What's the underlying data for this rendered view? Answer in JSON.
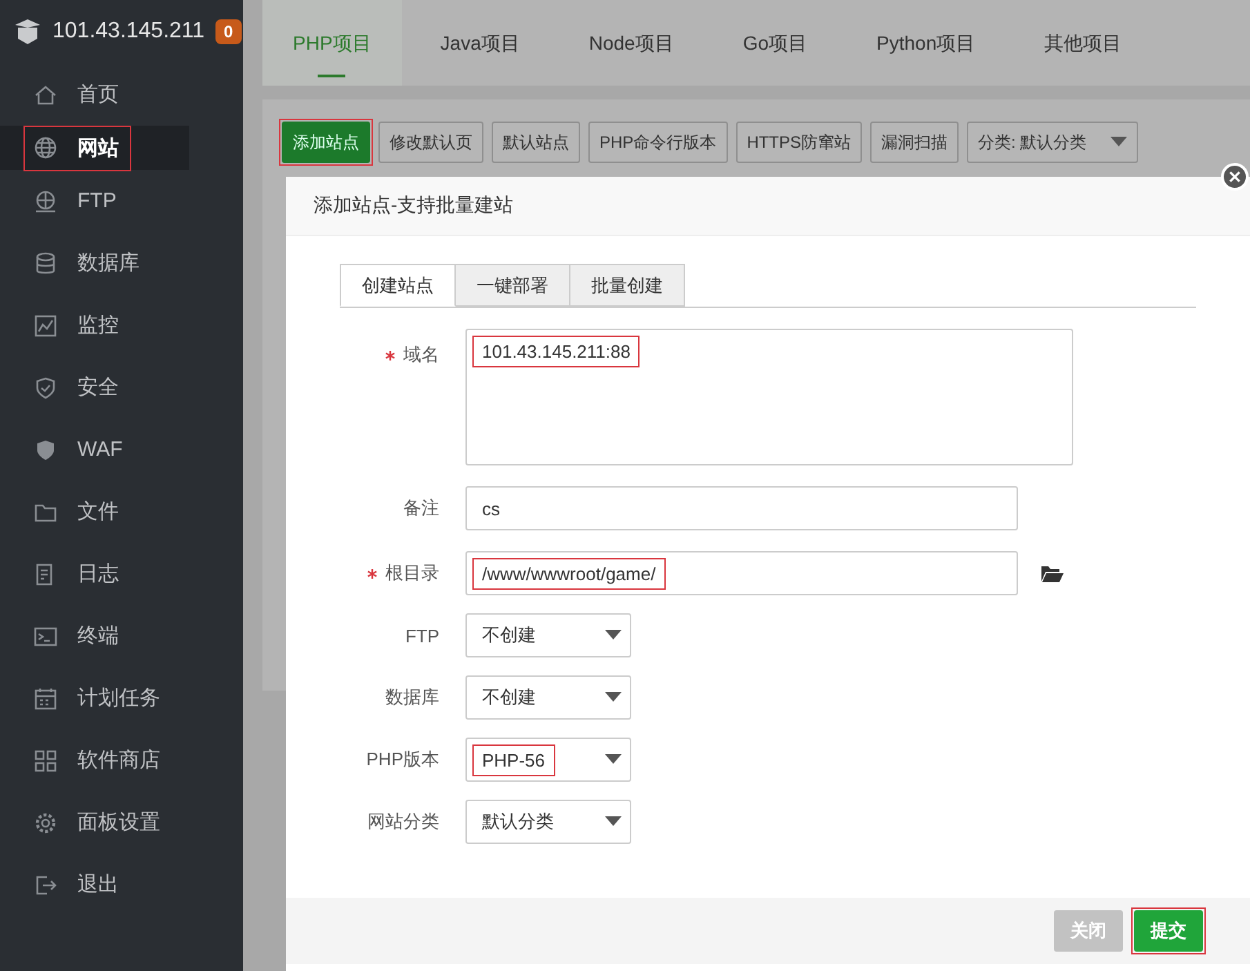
{
  "sidebar": {
    "server": "101.43.145.211",
    "badge": "0",
    "items": [
      {
        "label": "首页",
        "selected": false,
        "highlighted": false
      },
      {
        "label": "网站",
        "selected": true,
        "highlighted": true
      },
      {
        "label": "FTP",
        "selected": false,
        "highlighted": false
      },
      {
        "label": "数据库",
        "selected": false,
        "highlighted": false
      },
      {
        "label": "监控",
        "selected": false,
        "highlighted": false
      },
      {
        "label": "安全",
        "selected": false,
        "highlighted": false
      },
      {
        "label": "WAF",
        "selected": false,
        "highlighted": false
      },
      {
        "label": "文件",
        "selected": false,
        "highlighted": false
      },
      {
        "label": "日志",
        "selected": false,
        "highlighted": false
      },
      {
        "label": "终端",
        "selected": false,
        "highlighted": false
      },
      {
        "label": "计划任务",
        "selected": false,
        "highlighted": false
      },
      {
        "label": "软件商店",
        "selected": false,
        "highlighted": false
      },
      {
        "label": "面板设置",
        "selected": false,
        "highlighted": false
      },
      {
        "label": "退出",
        "selected": false,
        "highlighted": false
      }
    ]
  },
  "tabs": [
    {
      "label": "PHP项目",
      "selected": true
    },
    {
      "label": "Java项目",
      "selected": false
    },
    {
      "label": "Node项目",
      "selected": false
    },
    {
      "label": "Go项目",
      "selected": false
    },
    {
      "label": "Python项目",
      "selected": false
    },
    {
      "label": "其他项目",
      "selected": false
    }
  ],
  "toolbar": [
    {
      "label": "添加站点",
      "kind": "primary",
      "highlighted": true
    },
    {
      "label": "修改默认页",
      "kind": "plain",
      "highlighted": false
    },
    {
      "label": "默认站点",
      "kind": "plain",
      "highlighted": false
    },
    {
      "label": "PHP命令行版本",
      "kind": "plain",
      "highlighted": false
    },
    {
      "label": "HTTPS防窜站",
      "kind": "plain",
      "highlighted": false
    },
    {
      "label": "漏洞扫描",
      "kind": "plain",
      "highlighted": false
    },
    {
      "label": "分类: 默认分类",
      "kind": "select",
      "highlighted": false
    }
  ],
  "dialog": {
    "title": "添加站点-支持批量建站",
    "tabs": [
      {
        "label": "创建站点",
        "selected": true
      },
      {
        "label": "一键部署",
        "selected": false
      },
      {
        "label": "批量创建",
        "selected": false
      }
    ],
    "fields": [
      {
        "label": "域名",
        "required": true,
        "kind": "textarea",
        "value": "101.43.145.211:88",
        "highlighted": true
      },
      {
        "label": "备注",
        "required": false,
        "kind": "input",
        "value": "cs",
        "highlighted": false
      },
      {
        "label": "根目录",
        "required": true,
        "kind": "path",
        "value": "/www/wwwroot/game/",
        "highlighted": true
      },
      {
        "label": "FTP",
        "required": false,
        "kind": "select",
        "value": "不创建",
        "highlighted": false
      },
      {
        "label": "数据库",
        "required": false,
        "kind": "select",
        "value": "不创建",
        "highlighted": false
      },
      {
        "label": "PHP版本",
        "required": false,
        "kind": "select",
        "value": "PHP-56",
        "highlighted": true
      },
      {
        "label": "网站分类",
        "required": false,
        "kind": "select",
        "value": "默认分类",
        "highlighted": false
      }
    ],
    "buttons": [
      {
        "label": "关闭",
        "kind": "cancel",
        "highlighted": false
      },
      {
        "label": "提交",
        "kind": "primary",
        "highlighted": true
      }
    ]
  }
}
